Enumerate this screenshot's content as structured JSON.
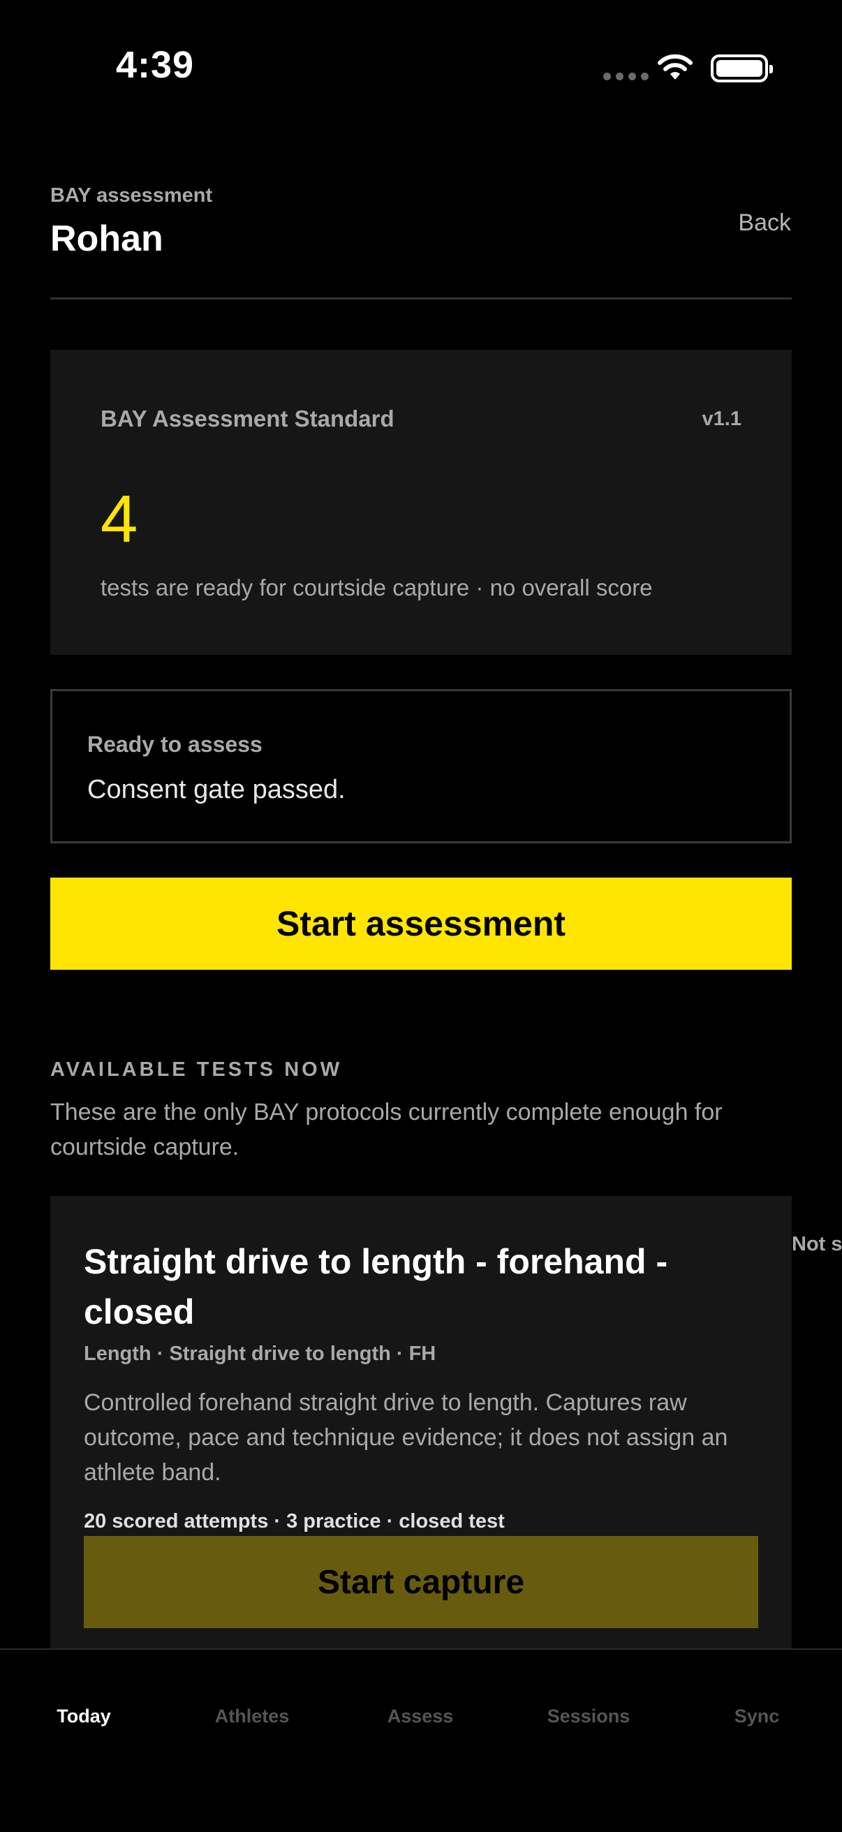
{
  "status_bar": {
    "time": "4:39"
  },
  "header": {
    "eyebrow": "BAY assessment",
    "athlete_name": "Rohan",
    "back_label": "Back"
  },
  "standard_card": {
    "title": "BAY Assessment Standard",
    "version": "v1.1",
    "ready_count": "4",
    "subtitle": "tests are ready for courtside capture · no overall score"
  },
  "ready_card": {
    "title": "Ready to assess",
    "message": "Consent gate passed."
  },
  "start_button": {
    "label": "Start assessment"
  },
  "available_tests": {
    "heading": "AVAILABLE TESTS NOW",
    "description": "These are the only BAY protocols currently complete enough for courtside capture.",
    "tests": [
      {
        "title": "Straight drive to length - forehand - closed",
        "meta": "Length · Straight drive to length · FH",
        "description": "Controlled forehand straight drive to length. Captures raw outcome, pace and technique evidence; it does not assign an athlete band.",
        "attempts": "20 scored attempts · 3 practice · closed test",
        "button_label": "Start capture"
      }
    ],
    "side_peek": "Not s"
  },
  "tab_bar": {
    "tabs": [
      {
        "label": "Today",
        "active": true
      },
      {
        "label": "Athletes",
        "active": false
      },
      {
        "label": "Assess",
        "active": false
      },
      {
        "label": "Sessions",
        "active": false
      },
      {
        "label": "Sync",
        "active": false
      }
    ]
  },
  "colors": {
    "accent": "#ffe500",
    "accent_dim": "#675b0e",
    "card": "#161616",
    "muted_text": "#a9a9a9"
  }
}
